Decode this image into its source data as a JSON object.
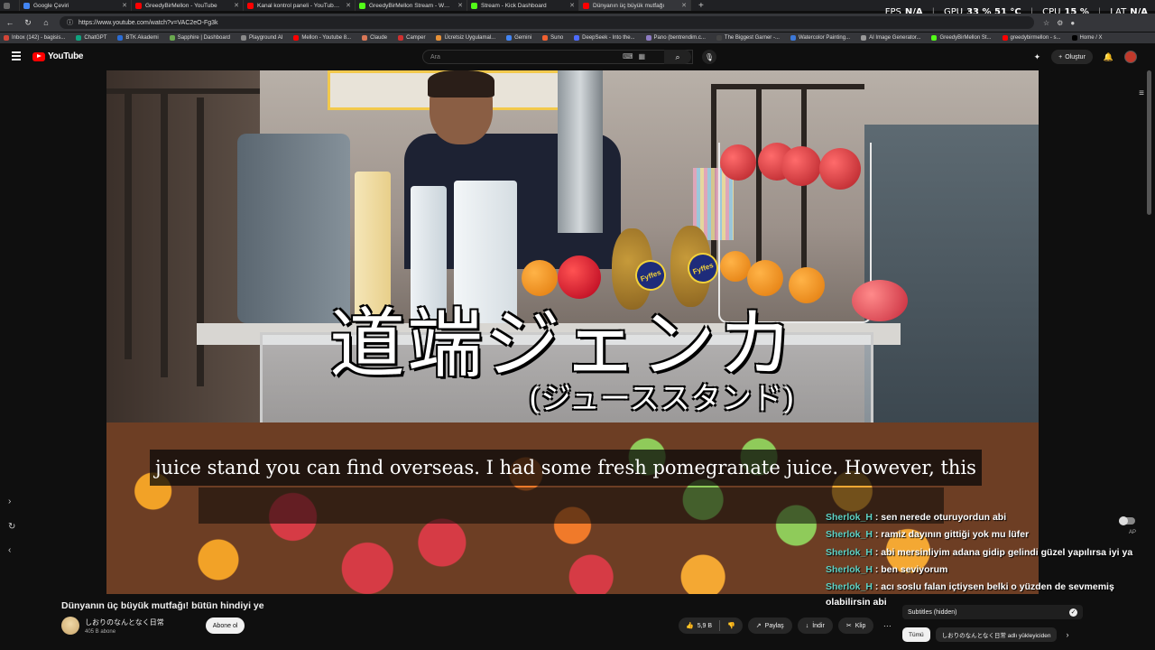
{
  "browser": {
    "tabs": [
      {
        "label": "Google Çeviri",
        "color": "#4285f4"
      },
      {
        "label": "GreedyBirMellon - YouTube",
        "color": "#ff0000"
      },
      {
        "label": "Kanal kontrol paneli - YouTube St",
        "color": "#ff0000"
      },
      {
        "label": "GreedyBirMellon Stream - Watch",
        "color": "#53fc18"
      },
      {
        "label": "Stream - Kick Dashboard",
        "color": "#53fc18"
      },
      {
        "label": "Dünyanın üç büyük mutfağı",
        "color": "#ff0000"
      }
    ],
    "url": "https://www.youtube.com/watch?v=VAC2eO-Fg3k",
    "bookmarks": [
      "Inbox (142) - bagisis...",
      "ChatGPT",
      "BTK Akademi",
      "Sapphire | Dashboard",
      "Playground AI",
      "Mellon - Youtube 8...",
      "Claude",
      "Camper",
      "Ücretsiz Uygulamal...",
      "Gemini",
      "Suno",
      "DeepSeek - Into the...",
      "Pano (bentrendim.c...",
      "The Biggest Garner -...",
      "Watercolor Painting...",
      "AI Image Generator...",
      "GreedyBirMellon St...",
      "greedybirmellon - s...",
      "Home / X"
    ]
  },
  "stats_overlay": {
    "fps_label": "FPS",
    "fps_value": "N/A",
    "gpu_label": "GPU",
    "gpu_value": "33 % 51 °C",
    "cpu_label": "CPU",
    "cpu_value": "15 %",
    "lat_label": "LAT",
    "lat_value": "N/A"
  },
  "header": {
    "logo_text": "YouTube",
    "search_placeholder": "Ara",
    "create_label": "Oluştur"
  },
  "video": {
    "jp_title": "道端ジェンカ",
    "jp_subtitle": "(ジューススタンド)",
    "caption": "juice stand you can find overseas. I had some fresh pomegranate juice. However, this",
    "pine_label": "Fyffes"
  },
  "chat": [
    {
      "user": "Sherlok_H",
      "text": " : sen nerede oturuyordun abi"
    },
    {
      "user": "Sherlok_H",
      "text": " : ramiz dayının gittiği yok mu lüfer"
    },
    {
      "user": "Sherlok_H",
      "text": " : abi mersinliyim adana gidip gelindi güzel yapılırsa iyi ya"
    },
    {
      "user": "Sherlok_H",
      "text": " : ben seviyorum"
    },
    {
      "user": "Sherlok_H",
      "text": " : acı soslu falan içtiysen belki o yüzden de sevmemiş olabilirsin abi"
    }
  ],
  "below": {
    "title": "Dünyanın üç büyük mutfağı! bütün hindiyi ye",
    "channel_name": "しおりのなんとなく日常",
    "channel_subs": "405 B abone",
    "subscribe_label": "Abone ol",
    "like_count": "5,9 B",
    "share_label": "Paylaş",
    "download_label": "İndir",
    "clip_label": "Klip",
    "subtitles_label": "Subtitles (hidden)",
    "chip_all": "Tümü",
    "chip_channel": "しおりのなんとなく日常 adlı yükleyiciden"
  },
  "side": {
    "ap_label": "AP"
  }
}
